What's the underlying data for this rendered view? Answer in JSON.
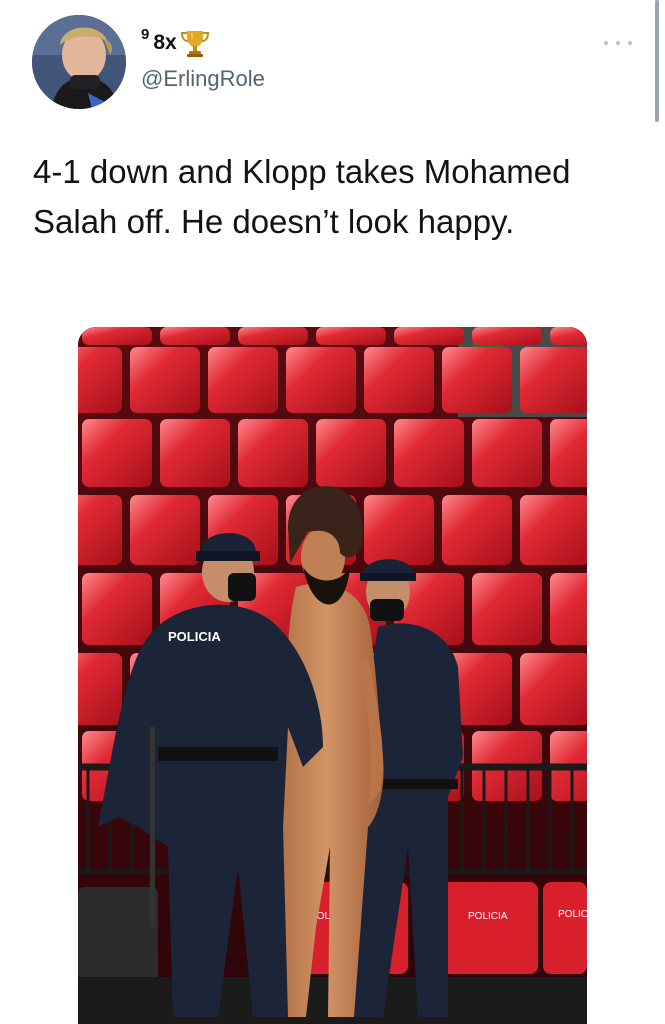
{
  "author": {
    "name_prefix": "9",
    "name": "8x",
    "badge_icon": "trophy-icon",
    "handle": "@ErlingRole",
    "avatar_icon": "avatar-photo"
  },
  "tweet": {
    "text": "4-1 down and Klopp takes Mohamed Salah off. He doesn’t look happy."
  },
  "media": {
    "kind": "photo",
    "jacket_print": "POLICIA",
    "seat_print": "POLICIA"
  },
  "menu": {
    "icon": "more-options-icon"
  },
  "colors": {
    "text": "#0f1419",
    "secondary_text": "#536471",
    "seat_red": "#d8202c",
    "uniform_navy": "#1c2438",
    "trophy_gold": "#d9a520"
  }
}
